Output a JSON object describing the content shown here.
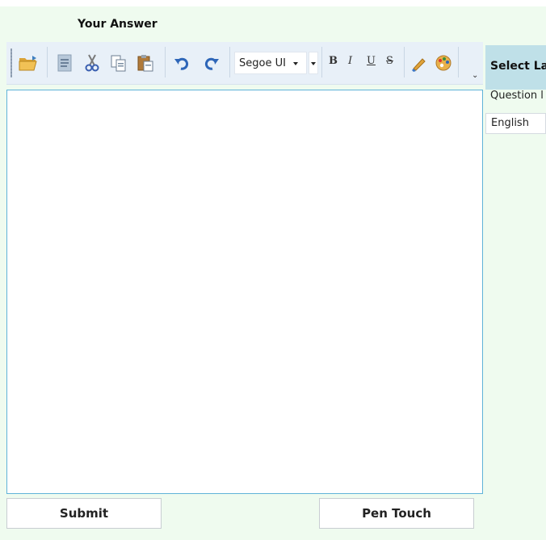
{
  "answer": {
    "title": "Your Answer"
  },
  "toolbar": {
    "icons": [
      "open-folder-icon",
      "document-icon",
      "cut-icon",
      "copy-icon",
      "paste-icon",
      "undo-icon",
      "redo-icon",
      "bold-icon",
      "italic-icon",
      "underline-icon",
      "strikethrough-icon",
      "highlighter-icon",
      "color-palette-icon"
    ],
    "font_name": "Segoe UI",
    "bold_label": "B",
    "italic_label": "I",
    "underline_label": "U",
    "strike_label": "S",
    "overflow_label": "⌄"
  },
  "editor": {
    "value": ""
  },
  "actions": {
    "submit_label": "Submit",
    "pen_touch_label": "Pen Touch"
  },
  "language": {
    "header": "Select La",
    "sub_label": "Question l",
    "selected": "English"
  },
  "colors": {
    "panel_bg": "#effbef",
    "toolbar_bg": "#e8f0f8",
    "editor_border": "#5fb3d8",
    "lang_header_bg": "#bfe0e8"
  }
}
